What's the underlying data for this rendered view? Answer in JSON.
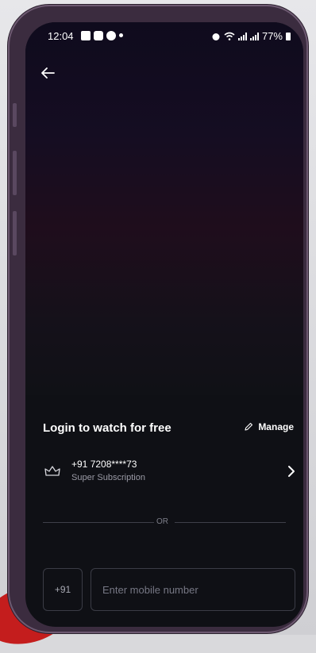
{
  "status_bar": {
    "time": "12:04",
    "battery": "77%"
  },
  "header": {
    "back_icon": "arrow-left-icon"
  },
  "login": {
    "title": "Login to watch for free",
    "manage_label": "Manage"
  },
  "subscription": {
    "phone": "+91 7208****73",
    "plan": "Super Subscription"
  },
  "divider": {
    "label": "OR"
  },
  "mobile_input": {
    "country_code": "+91",
    "placeholder": "Enter mobile number",
    "value": ""
  },
  "colors": {
    "screen_bg": "#0f1015",
    "accent_red": "#c41d1d",
    "frame": "#3b2c3f"
  }
}
